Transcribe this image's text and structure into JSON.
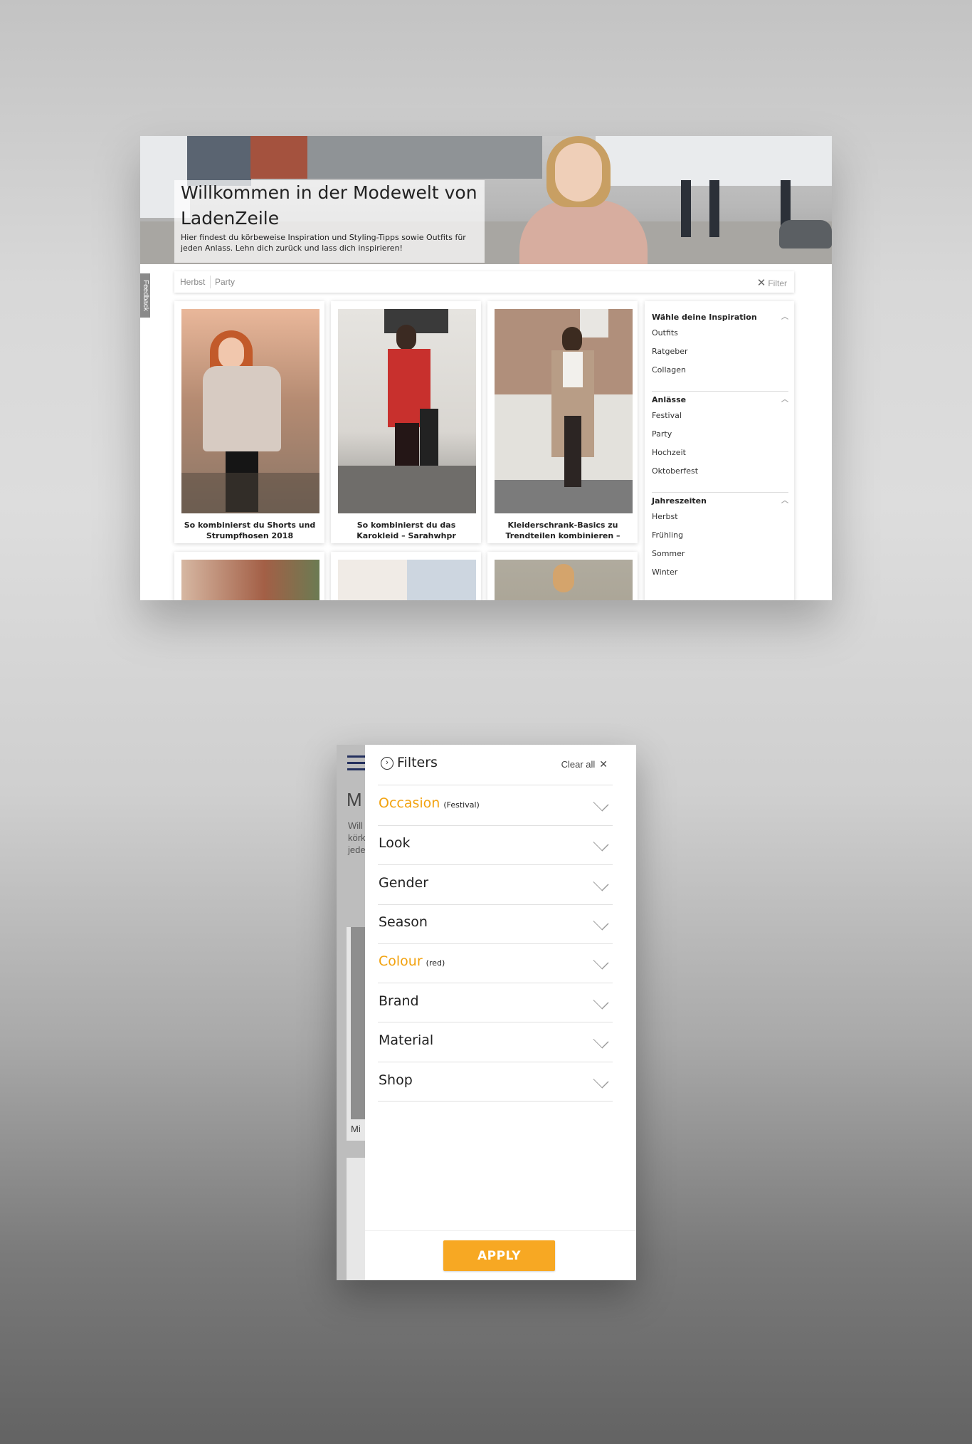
{
  "desktop": {
    "hero": {
      "title": "Willkommen in der Modewelt von LadenZeile",
      "subtitle": "Hier findest du körbeweise Inspiration und Styling-Tipps sowie Outfits für jeden Anlass. Lehn dich zurück und lass dich inspirieren!"
    },
    "feedback_label": "Feedback",
    "filter_bar": {
      "chips": [
        "Herbst",
        "Party"
      ],
      "filter_label": "Filter"
    },
    "cards": [
      {
        "caption": "So kombinierst du Shorts und Strumpfhosen 2018"
      },
      {
        "caption": "So kombinierst du das Karokleid – Sarahwhpr"
      },
      {
        "caption": "Kleiderschrank-Basics zu Trendteilen kombinieren –"
      }
    ],
    "sidebar": {
      "groups": [
        {
          "title": "Wähle deine Inspiration",
          "items": [
            "Outfits",
            "Ratgeber",
            "Collagen"
          ]
        },
        {
          "title": "Anlässe",
          "items": [
            "Festival",
            "Party",
            "Hochzeit",
            "Oktoberfest"
          ]
        },
        {
          "title": "Jahreszeiten",
          "items": [
            "Herbst",
            "Frühling",
            "Sommer",
            "Winter"
          ]
        }
      ]
    }
  },
  "mobile": {
    "background": {
      "heading_letter": "M",
      "intro_lines": [
        "Will",
        "körk",
        "jede"
      ],
      "card_text": "Mi"
    },
    "panel": {
      "title": "Filters",
      "clear_all": "Clear all",
      "rows": [
        {
          "label": "Occasion",
          "selected": "(Festival)",
          "active": true
        },
        {
          "label": "Look",
          "selected": "",
          "active": false
        },
        {
          "label": "Gender",
          "selected": "",
          "active": false
        },
        {
          "label": "Season",
          "selected": "",
          "active": false
        },
        {
          "label": "Colour",
          "selected": "(red)",
          "active": true
        },
        {
          "label": "Brand",
          "selected": "",
          "active": false
        },
        {
          "label": "Material",
          "selected": "",
          "active": false
        },
        {
          "label": "Shop",
          "selected": "",
          "active": false
        }
      ],
      "apply_label": "APPLY"
    }
  },
  "colors": {
    "accent": "#f2a20f",
    "apply_button": "#f7a823",
    "menu_icon": "#24305e"
  },
  "icons": [
    "close-icon",
    "chevron-up-icon",
    "back-circle-icon",
    "chevron-down-icon",
    "hamburger-menu-icon"
  ]
}
